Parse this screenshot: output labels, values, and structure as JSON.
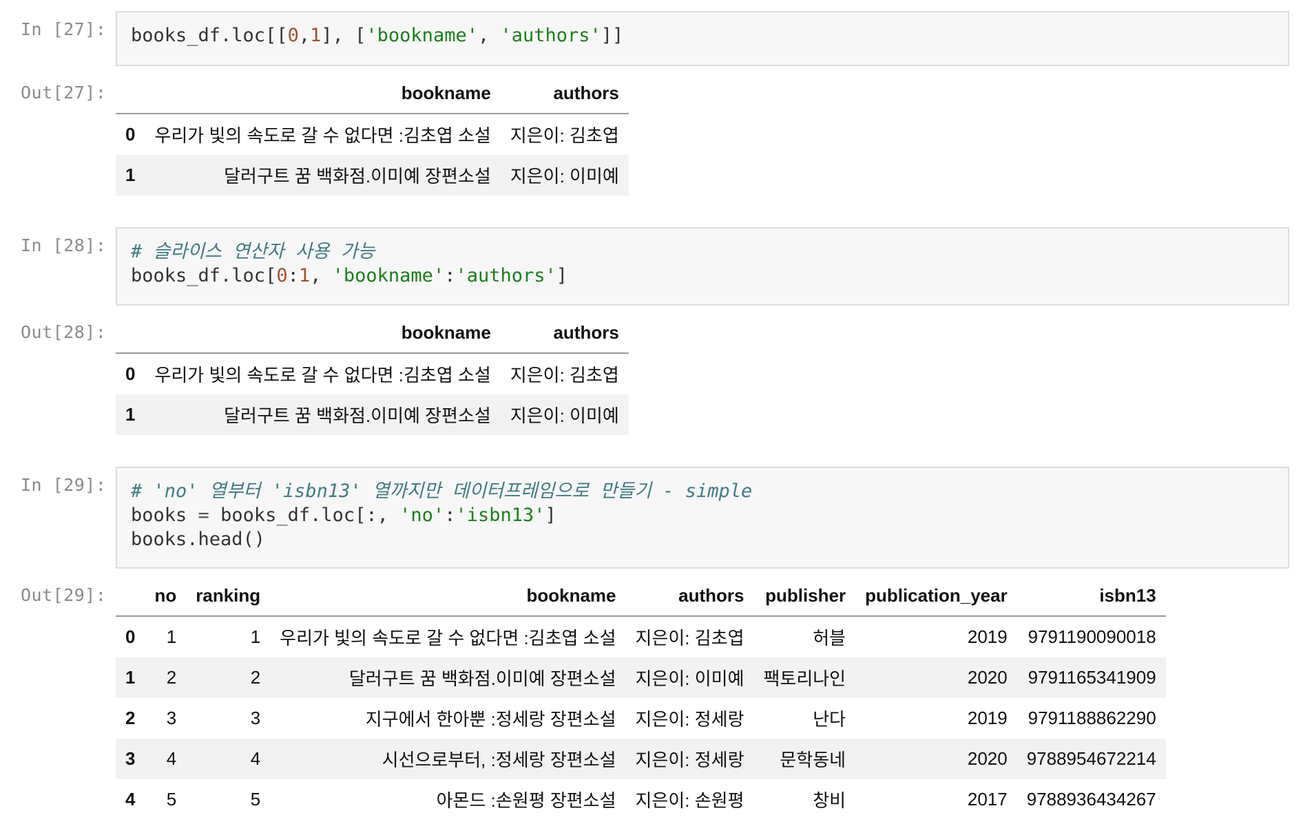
{
  "cells": [
    {
      "in_prompt": "In [27]:",
      "code_lines": [
        [
          {
            "t": "books_df.loc[[",
            "c": "plain"
          },
          {
            "t": "0",
            "c": "num"
          },
          {
            "t": ",",
            "c": "plain"
          },
          {
            "t": "1",
            "c": "num"
          },
          {
            "t": "], [",
            "c": "plain"
          },
          {
            "t": "'bookname'",
            "c": "str"
          },
          {
            "t": ", ",
            "c": "plain"
          },
          {
            "t": "'authors'",
            "c": "str"
          },
          {
            "t": "]]",
            "c": "plain"
          }
        ]
      ],
      "out_prompt": "Out[27]:",
      "table": {
        "columns": [
          "",
          "bookname",
          "authors"
        ],
        "rows": [
          [
            "0",
            "우리가 빛의 속도로 갈 수 없다면 :김초엽 소설",
            "지은이: 김초엽"
          ],
          [
            "1",
            "달러구트 꿈 백화점.이미예 장편소설",
            "지은이: 이미예"
          ]
        ]
      }
    },
    {
      "in_prompt": "In [28]:",
      "code_lines": [
        [
          {
            "t": "# 슬라이스 연산자 사용 가능",
            "c": "com"
          }
        ],
        [
          {
            "t": "books_df.loc[",
            "c": "plain"
          },
          {
            "t": "0",
            "c": "num"
          },
          {
            "t": ":",
            "c": "plain"
          },
          {
            "t": "1",
            "c": "num"
          },
          {
            "t": ", ",
            "c": "plain"
          },
          {
            "t": "'bookname'",
            "c": "str"
          },
          {
            "t": ":",
            "c": "plain"
          },
          {
            "t": "'authors'",
            "c": "str"
          },
          {
            "t": "]",
            "c": "plain"
          }
        ]
      ],
      "out_prompt": "Out[28]:",
      "table": {
        "columns": [
          "",
          "bookname",
          "authors"
        ],
        "rows": [
          [
            "0",
            "우리가 빛의 속도로 갈 수 없다면 :김초엽 소설",
            "지은이: 김초엽"
          ],
          [
            "1",
            "달러구트 꿈 백화점.이미예 장편소설",
            "지은이: 이미예"
          ]
        ]
      }
    },
    {
      "in_prompt": "In [29]:",
      "code_lines": [
        [
          {
            "t": "# 'no' 열부터 'isbn13' 열까지만 데이터프레임으로 만들기 - simple",
            "c": "com"
          }
        ],
        [
          {
            "t": "books ",
            "c": "plain"
          },
          {
            "t": "=",
            "c": "op"
          },
          {
            "t": " books_df.loc[:, ",
            "c": "plain"
          },
          {
            "t": "'no'",
            "c": "str"
          },
          {
            "t": ":",
            "c": "plain"
          },
          {
            "t": "'isbn13'",
            "c": "str"
          },
          {
            "t": "]",
            "c": "plain"
          }
        ],
        [
          {
            "t": "books.head()",
            "c": "plain"
          }
        ]
      ],
      "out_prompt": "Out[29]:",
      "table": {
        "columns": [
          "",
          "no",
          "ranking",
          "bookname",
          "authors",
          "publisher",
          "publication_year",
          "isbn13"
        ],
        "rows": [
          [
            "0",
            "1",
            "1",
            "우리가 빛의 속도로 갈 수 없다면 :김초엽 소설",
            "지은이: 김초엽",
            "허블",
            "2019",
            "9791190090018"
          ],
          [
            "1",
            "2",
            "2",
            "달러구트 꿈 백화점.이미예 장편소설",
            "지은이: 이미예",
            "팩토리나인",
            "2020",
            "9791165341909"
          ],
          [
            "2",
            "3",
            "3",
            "지구에서 한아뿐 :정세랑 장편소설",
            "지은이: 정세랑",
            "난다",
            "2019",
            "9791188862290"
          ],
          [
            "3",
            "4",
            "4",
            "시선으로부터, :정세랑 장편소설",
            "지은이: 정세랑",
            "문학동네",
            "2020",
            "9788954672214"
          ],
          [
            "4",
            "5",
            "5",
            "아몬드 :손원평 장편소설",
            "지은이: 손원평",
            "창비",
            "2017",
            "9788936434267"
          ]
        ]
      }
    }
  ]
}
